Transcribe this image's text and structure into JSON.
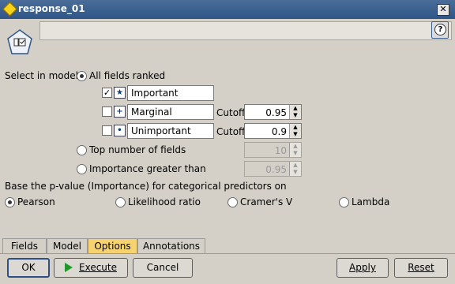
{
  "window": {
    "title": "response_01",
    "close_glyph": "✕"
  },
  "header": {
    "help_glyph": "?"
  },
  "select_model": {
    "label": "Select in model:",
    "all_fields_ranked": "All fields ranked",
    "rows": [
      {
        "text": "Important",
        "checked": true,
        "icon": "★"
      },
      {
        "text": "Marginal",
        "checked": false,
        "icon": "+",
        "cutoff_label": "Cutoff",
        "cutoff": "0.95"
      },
      {
        "text": "Unimportant",
        "checked": false,
        "icon": "•",
        "cutoff_label": "Cutoff",
        "cutoff": "0.9"
      }
    ],
    "top_number_label": "Top number of fields",
    "top_number_value": "10",
    "importance_label": "Importance greater than",
    "importance_value": "0.95"
  },
  "pvalue": {
    "label": "Base the p-value (Importance) for categorical predictors on",
    "options": [
      "Pearson",
      "Likelihood ratio",
      "Cramer's V",
      "Lambda"
    ],
    "selected": "Pearson"
  },
  "tabs": [
    "Fields",
    "Model",
    "Options",
    "Annotations"
  ],
  "active_tab": "Options",
  "buttons": {
    "ok": "OK",
    "execute": "Execute",
    "cancel": "Cancel",
    "apply": "Apply",
    "reset": "Reset"
  },
  "colors": {
    "titlebar": "#2f5688",
    "active_tab": "#f6d36f",
    "execute_arrow": "#1f9a2a"
  }
}
